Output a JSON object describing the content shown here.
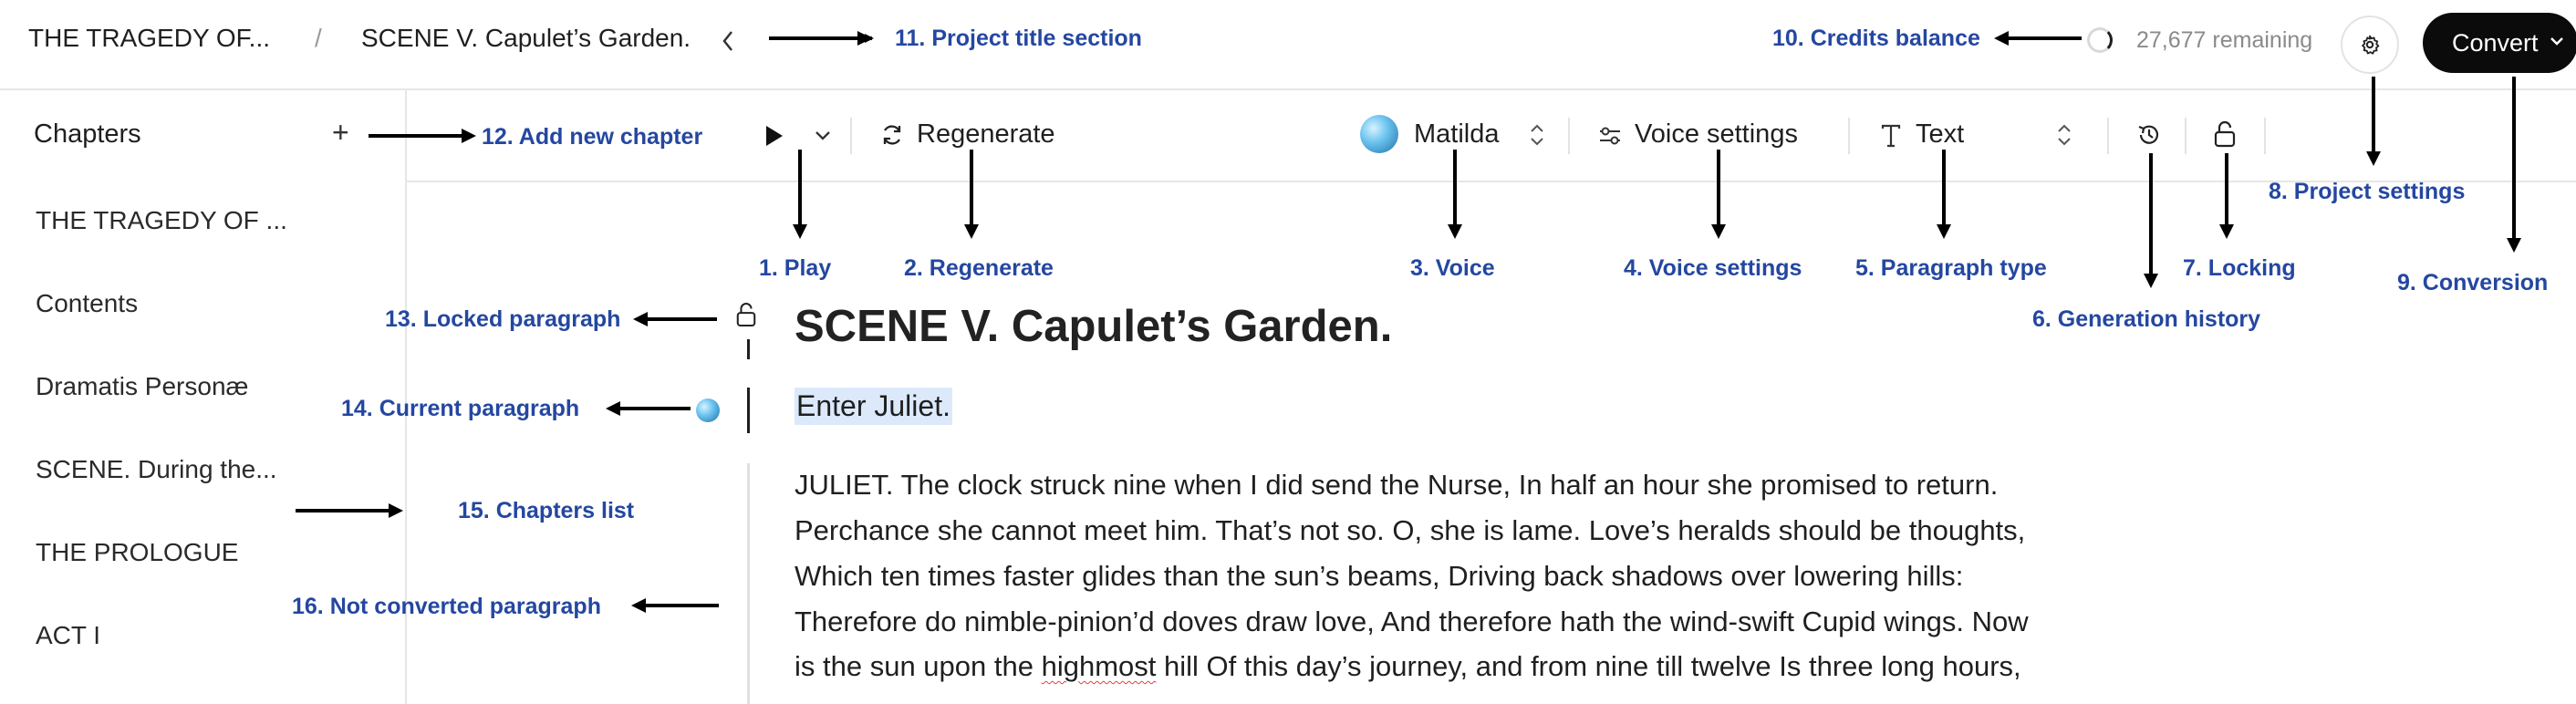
{
  "header": {
    "breadcrumb_root": "THE TRAGEDY OF...",
    "separator": "/",
    "breadcrumb_current": "SCENE V. Capulet’s Garden.",
    "credits_text": "27,677 remaining",
    "convert_label": "Convert"
  },
  "sidebar": {
    "title": "Chapters",
    "add_icon": "+",
    "items": [
      {
        "label": "THE TRAGEDY OF ..."
      },
      {
        "label": "Contents"
      },
      {
        "label": "Dramatis Personæ"
      },
      {
        "label": "SCENE. During the..."
      },
      {
        "label": "THE PROLOGUE"
      },
      {
        "label": "ACT I"
      }
    ]
  },
  "toolbar": {
    "regenerate_label": "Regenerate",
    "voice_name": "Matilda",
    "voice_settings_label": "Voice settings",
    "paragraph_type_label": "Text"
  },
  "editor": {
    "scene_title": "SCENE V. Capulet’s Garden.",
    "current_paragraph": "Enter Juliet.",
    "paragraph_lines": [
      "JULIET. The clock struck nine when I did send the Nurse, In half an hour she promised to return.",
      "Perchance she cannot meet him. That’s not so. O, she is lame. Love’s heralds should be thoughts,",
      "Which ten times faster glides than the sun’s beams, Driving back shadows over lowering hills:",
      "Therefore do nimble-pinion’d doves draw love, And therefore hath the wind-swift Cupid wings. Now",
      "is the sun upon the ",
      "highmost",
      " hill Of this day’s journey, and from nine till twelve Is three long hours,"
    ]
  },
  "annotations": {
    "a1": "1. Play",
    "a2": "2. Regenerate",
    "a3": "3. Voice",
    "a4": "4. Voice settings",
    "a5": "5. Paragraph type",
    "a6": "6. Generation history",
    "a7": "7. Locking",
    "a8": "8. Project settings",
    "a9": "9. Conversion",
    "a10": "10. Credits balance",
    "a11": "11. Project title section",
    "a12": "12. Add new chapter",
    "a13": "13. Locked paragraph",
    "a14": "14. Current paragraph",
    "a15": "15. Chapters list",
    "a16": "16. Not converted paragraph"
  },
  "icons": {
    "back": "chevron-left-icon",
    "credits": "spinner-icon",
    "settings": "gear-icon",
    "play": "play-icon",
    "regenerate": "refresh-icon",
    "voice_settings": "sliders-icon",
    "paragraph_type": "text-type-icon",
    "history": "history-icon",
    "lock": "lock-icon"
  }
}
